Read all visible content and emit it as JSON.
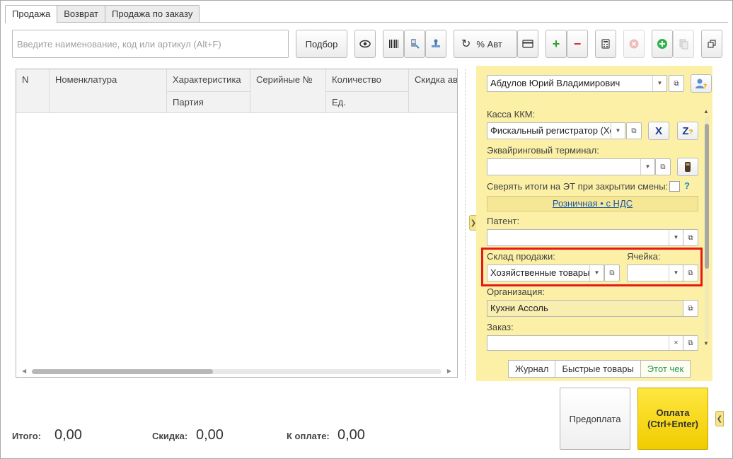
{
  "tabs": [
    {
      "label": "Продажа",
      "active": true
    },
    {
      "label": "Возврат",
      "active": false
    },
    {
      "label": "Продажа по заказу",
      "active": false
    }
  ],
  "toolbar": {
    "search_placeholder": "Введите наименование, код или артикул (Alt+F)",
    "select_label": "Подбор",
    "auto_discount_label": "% Авт",
    "icons": [
      "eye-icon",
      "barcode-icon",
      "scanner-icon",
      "stamp-icon",
      "refresh-icon",
      "card-icon",
      "plus-icon",
      "minus-icon",
      "calculator-icon",
      "cancel-icon",
      "add-green-icon",
      "copy-doc-icon",
      "expand-icon"
    ]
  },
  "table": {
    "columns_top": [
      "N",
      "Номенклатура",
      "Характеристика",
      "Серийные №",
      "Количество",
      "Скидка ав"
    ],
    "columns_bottom": [
      "Партия",
      "Ед."
    ],
    "rows": []
  },
  "panel": {
    "cashier": "Абдулов Юрий Владимирович",
    "kkm_label": "Касса ККМ:",
    "kkm_value": "Фискальный регистратор (Хо",
    "acquiring_label": "Эквайринговый терминал:",
    "acquiring_value": "",
    "reconcile_label": "Сверять итоги на ЭТ при закрытии смены:",
    "reconcile_help": "?",
    "price_type_link": "Розничная • с НДС",
    "patent_label": "Патент:",
    "patent_value": "",
    "warehouse_label": "Склад продажи:",
    "warehouse_value": "Хозяйственные товары",
    "cell_label": "Ячейка:",
    "cell_value": "",
    "org_label": "Организация:",
    "org_value": "Кухни Ассоль",
    "order_label": "Заказ:",
    "order_value": "",
    "bottom_tabs": [
      {
        "label": "Журнал",
        "active": false
      },
      {
        "label": "Быстрые товары",
        "active": false
      },
      {
        "label": "Этот чек",
        "active": true
      }
    ]
  },
  "buttons": {
    "prepay": "Предоплата",
    "pay_line1": "Оплата",
    "pay_line2": "(Ctrl+Enter)"
  },
  "totals": {
    "total_label": "Итого:",
    "total_value": "0,00",
    "discount_label": "Скидка:",
    "discount_value": "0,00",
    "to_pay_label": "К оплате:",
    "to_pay_value": "0,00"
  },
  "colors": {
    "panel_bg": "#fbf0a6",
    "pay_button": "#f5d400",
    "highlight": "#e61919",
    "link": "#1c57a7",
    "active_tab_green": "#1e9b55"
  }
}
